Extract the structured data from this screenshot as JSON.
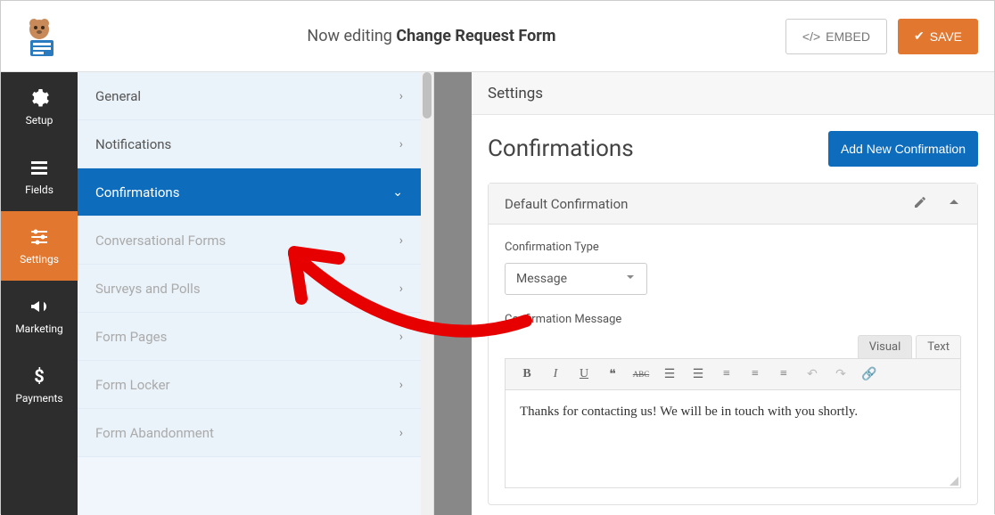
{
  "header": {
    "editing_prefix": "Now editing",
    "form_name": "Change Request Form",
    "embed_label": "EMBED",
    "save_label": "SAVE"
  },
  "left_nav": [
    {
      "label": "Setup",
      "icon": "gear"
    },
    {
      "label": "Fields",
      "icon": "list"
    },
    {
      "label": "Settings",
      "icon": "sliders",
      "active": true
    },
    {
      "label": "Marketing",
      "icon": "bullhorn"
    },
    {
      "label": "Payments",
      "icon": "dollar"
    }
  ],
  "sub_nav": [
    {
      "label": "General"
    },
    {
      "label": "Notifications"
    },
    {
      "label": "Confirmations",
      "active": true
    },
    {
      "label": "Conversational Forms",
      "muted": true
    },
    {
      "label": "Surveys and Polls",
      "muted": true
    },
    {
      "label": "Form Pages",
      "muted": true
    },
    {
      "label": "Form Locker",
      "muted": true
    },
    {
      "label": "Form Abandonment",
      "muted": true
    }
  ],
  "content": {
    "header": "Settings",
    "section_title": "Confirmations",
    "add_button": "Add New Confirmation",
    "panel_title": "Default Confirmation",
    "type_label": "Confirmation Type",
    "type_value": "Message",
    "message_label": "Confirmation Message",
    "tabs": {
      "visual": "Visual",
      "text": "Text"
    },
    "message_body": "Thanks for contacting us! We will be in touch with you shortly."
  }
}
